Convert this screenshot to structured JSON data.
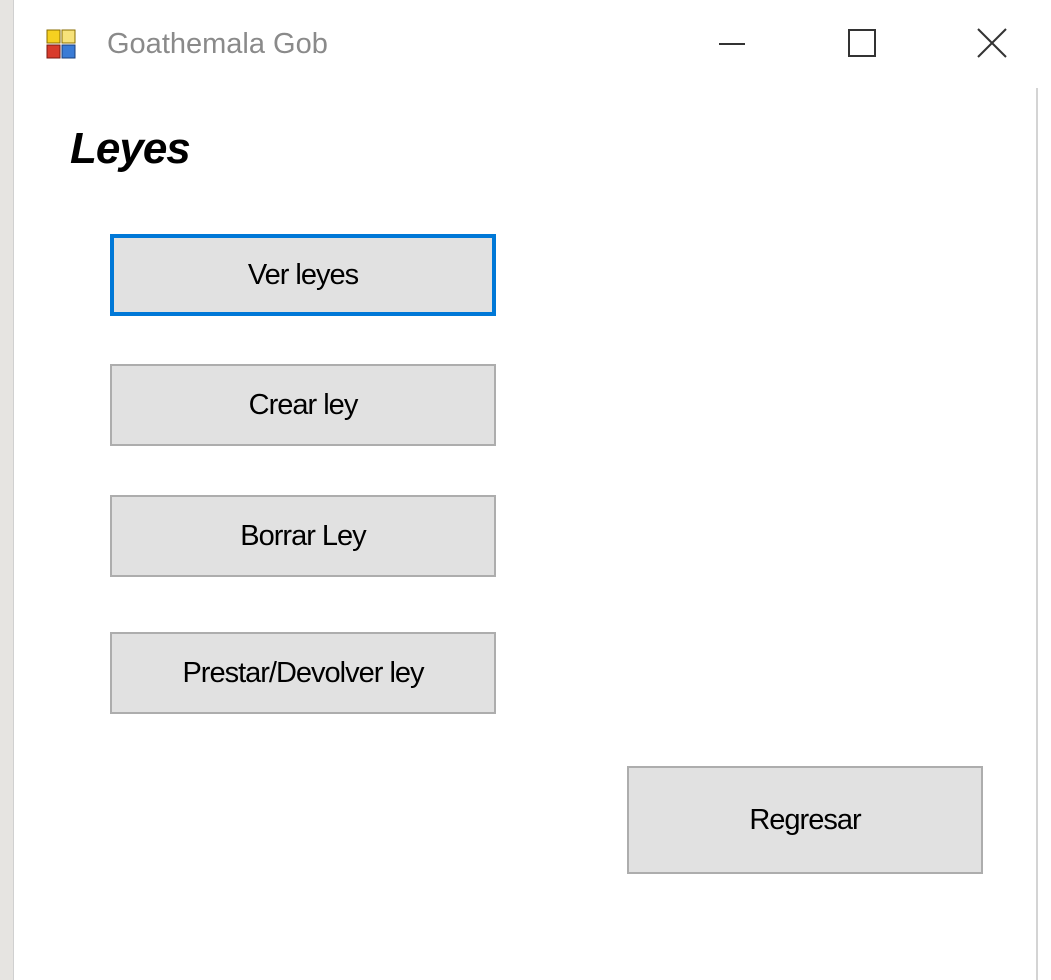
{
  "window": {
    "title": "Goathemala Gob",
    "controls": {
      "minimize": "minimize-icon",
      "maximize": "maximize-icon",
      "close": "close-icon"
    }
  },
  "main": {
    "heading": "Leyes",
    "buttons": {
      "ver_leyes": "Ver leyes",
      "crear_ley": "Crear ley",
      "borrar_ley": "Borrar Ley",
      "prestar_devolver": "Prestar/Devolver ley",
      "regresar": "Regresar"
    }
  },
  "colors": {
    "focus_border": "#0078d7",
    "button_face": "#e1e1e1",
    "button_border": "#adadad"
  }
}
